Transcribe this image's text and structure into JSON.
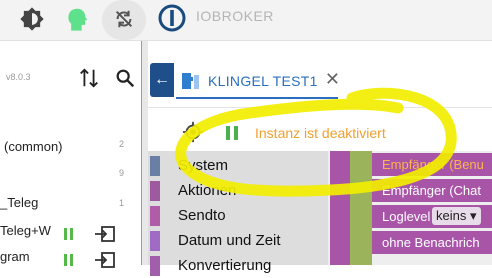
{
  "app": {
    "brand": "IOBROKER",
    "version": "v8.0.3"
  },
  "sidebar": {
    "items": [
      {
        "label": "(common)",
        "count": "2"
      },
      {
        "label": "",
        "count": "9"
      },
      {
        "label": "_Teleg",
        "count": "1"
      },
      {
        "label": "Teleg+W",
        "count": ""
      },
      {
        "label": "gram",
        "count": ""
      }
    ]
  },
  "tab": {
    "title": "KLINGEL TEST1",
    "back_label": "←",
    "close_label": "✕"
  },
  "instance": {
    "status": "Instanz ist deaktiviert"
  },
  "palette": {
    "items": [
      {
        "label": "System",
        "color": "#6a7fa6"
      },
      {
        "label": "Aktionen",
        "color": "#9d5aa0"
      },
      {
        "label": "Sendto",
        "color": "#b05ca8"
      },
      {
        "label": "Datum und Zeit",
        "color": "#a06bc4"
      },
      {
        "label": "Konvertierung",
        "color": "#a15eaa"
      }
    ]
  },
  "workspace": {
    "blocks": [
      {
        "text": "Empfänger (Benu",
        "accent": true
      },
      {
        "text": "Empfänger (Chat",
        "accent": false
      },
      {
        "text": "Loglevel",
        "accent": false,
        "dropdown": "keins ▾"
      },
      {
        "text": "ohne Benachrich",
        "accent": false
      }
    ]
  },
  "colors": {
    "accent_blue": "#2a6fbf",
    "status_orange": "#f0a030",
    "highlight_yellow": "#f2ee00",
    "block_purple": "#a855a8"
  }
}
